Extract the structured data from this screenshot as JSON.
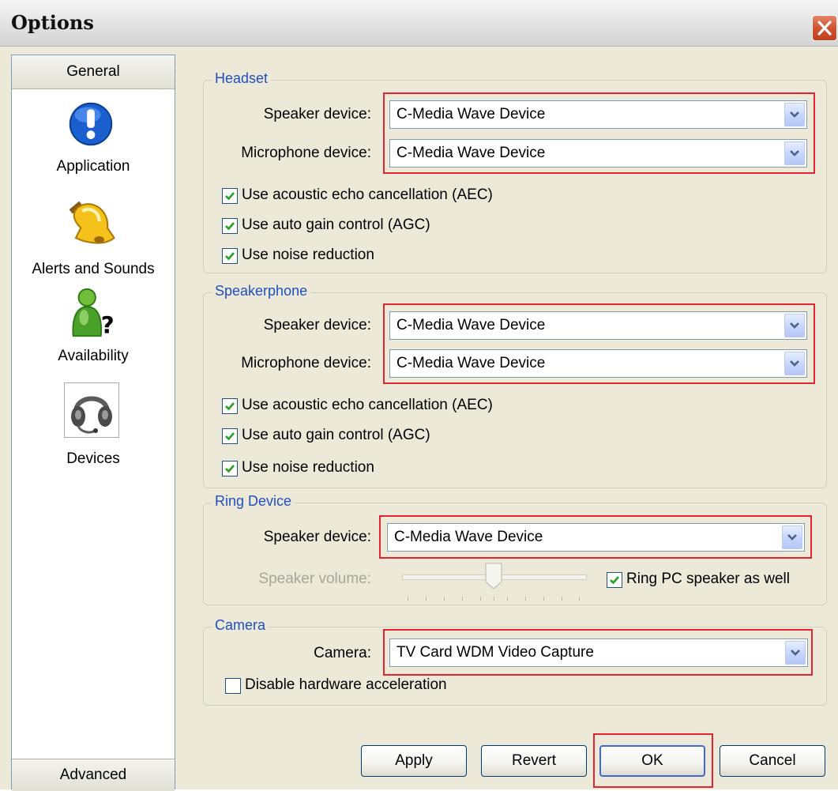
{
  "window": {
    "title": "Options"
  },
  "sidebar": {
    "header": "General",
    "items": [
      {
        "label": "Application",
        "icon": "info-exclamation-icon"
      },
      {
        "label": "Alerts and Sounds",
        "icon": "bell-icon"
      },
      {
        "label": "Availability",
        "icon": "presence-question-icon"
      },
      {
        "label": "Devices",
        "icon": "headset-icon"
      }
    ],
    "footer": "Advanced"
  },
  "headset": {
    "title": "Headset",
    "speaker_label": "Speaker device:",
    "speaker_value": "C-Media Wave Device",
    "mic_label": "Microphone device:",
    "mic_value": "C-Media Wave Device",
    "aec_label": "Use acoustic echo cancellation (AEC)",
    "aec_checked": true,
    "agc_label": "Use auto gain control (AGC)",
    "agc_checked": true,
    "nr_label": "Use noise reduction",
    "nr_checked": true
  },
  "speakerphone": {
    "title": "Speakerphone",
    "speaker_label": "Speaker device:",
    "speaker_value": "C-Media Wave Device",
    "mic_label": "Microphone device:",
    "mic_value": "C-Media Wave Device",
    "aec_label": "Use acoustic echo cancellation (AEC)",
    "aec_checked": true,
    "agc_label": "Use auto gain control (AGC)",
    "agc_checked": true,
    "nr_label": "Use noise reduction",
    "nr_checked": true
  },
  "ring": {
    "title": "Ring Device",
    "speaker_label": "Speaker device:",
    "speaker_value": "C-Media Wave Device",
    "volume_label": "Speaker volume:",
    "volume_level": 0.5,
    "pc_speaker_label": "Ring PC speaker as well",
    "pc_speaker_checked": true
  },
  "camera": {
    "title": "Camera",
    "camera_label": "Camera:",
    "camera_value": "TV Card WDM Video Capture",
    "hw_accel_label": "Disable hardware acceleration",
    "hw_accel_checked": false
  },
  "buttons": {
    "apply": "Apply",
    "revert": "Revert",
    "ok": "OK",
    "cancel": "Cancel"
  },
  "colors": {
    "highlight_box": "#e4252f",
    "group_title": "#1f4fc0",
    "dialog_bg": "#ece9d8"
  }
}
